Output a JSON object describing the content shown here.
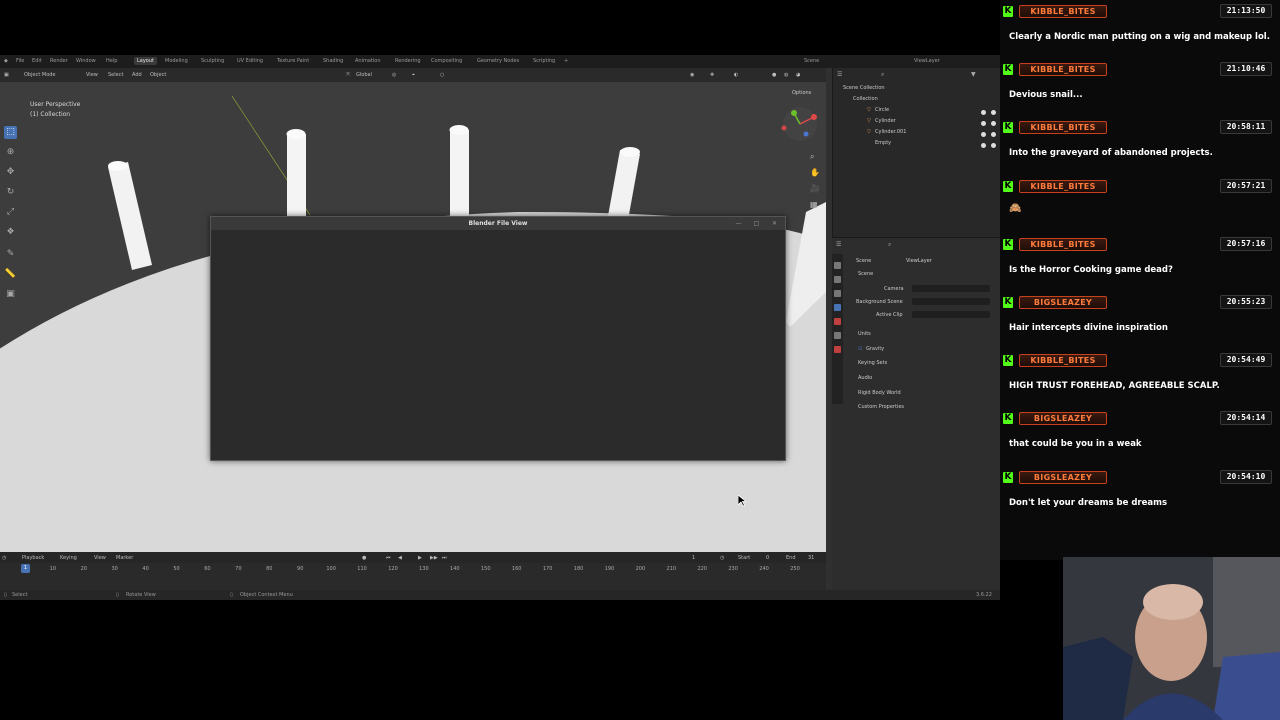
{
  "blender": {
    "menus": [
      "File",
      "Edit",
      "Render",
      "Window",
      "Help"
    ],
    "workspaces": [
      "Layout",
      "Modeling",
      "Sculpting",
      "UV Editing",
      "Texture Paint",
      "Shading",
      "Animation",
      "Rendering",
      "Compositing",
      "Geometry Nodes",
      "Scripting"
    ],
    "active_workspace": "Layout",
    "scene_label": "Scene",
    "view_layer_label": "ViewLayer",
    "viewport_header": {
      "mode": "Object Mode",
      "view": "View",
      "select": "Select",
      "add": "Add",
      "object": "Object",
      "orientation": "Global",
      "options": "Options"
    },
    "viewport": {
      "perspective": "User Perspective",
      "collection": "(1) Collection"
    },
    "dialog": {
      "title": "Blender File View"
    },
    "outliner": {
      "root": "Scene Collection",
      "collection": "Collection",
      "items": [
        "Circle",
        "Cylinder",
        "Cylinder.001",
        "Empty"
      ]
    },
    "properties": {
      "breadcrumb_scene": "Scene",
      "breadcrumb_viewlayer": "ViewLayer",
      "section_scene": "Scene",
      "camera_label": "Camera",
      "background_label": "Background Scene",
      "clip_label": "Active Clip",
      "panels": [
        "Units",
        "Gravity",
        "Keying Sets",
        "Audio",
        "Rigid Body World",
        "Custom Properties"
      ],
      "gravity_checked": true
    },
    "timeline": {
      "playback": "Playback",
      "keying": "Keying",
      "view": "View",
      "marker": "Marker",
      "current_frame": "1",
      "start_label": "Start",
      "start_value": "0",
      "end_label": "End",
      "end_value": "31",
      "ticks": [
        "1",
        "10",
        "20",
        "30",
        "40",
        "50",
        "60",
        "70",
        "80",
        "90",
        "100",
        "110",
        "120",
        "130",
        "140",
        "150",
        "160",
        "170",
        "180",
        "190",
        "200",
        "210",
        "220",
        "230",
        "240",
        "250"
      ]
    },
    "statusbar": {
      "select": "Select",
      "rotate": "Rotate View",
      "context": "Object Context Menu",
      "version": "3.6.22"
    }
  },
  "chat": {
    "badge_letter": "K",
    "messages": [
      {
        "user": "KIBBLE_BITES",
        "time": "21:13:50",
        "text": "Clearly a Nordic man putting on a wig and makeup lol."
      },
      {
        "user": "KIBBLE_BITES",
        "time": "21:10:46",
        "text": "Devious snail..."
      },
      {
        "user": "KIBBLE_BITES",
        "time": "20:58:11",
        "text": "Into the graveyard of abandoned projects."
      },
      {
        "user": "KIBBLE_BITES",
        "time": "20:57:21",
        "text": "",
        "emote": "🙈"
      },
      {
        "user": "KIBBLE_BITES",
        "time": "20:57:16",
        "text": "Is the Horror Cooking game dead?"
      },
      {
        "user": "BIGSLEAZEY",
        "time": "20:55:23",
        "text": "Hair intercepts divine inspiration"
      },
      {
        "user": "KIBBLE_BITES",
        "time": "20:54:49",
        "text": "HIGH TRUST FOREHEAD, AGREEABLE SCALP."
      },
      {
        "user": "BIGSLEAZEY",
        "time": "20:54:14",
        "text": "that could be you in a weak"
      },
      {
        "user": "BIGSLEAZEY",
        "time": "20:54:10",
        "text": "Don't let your dreams be dreams"
      }
    ]
  }
}
